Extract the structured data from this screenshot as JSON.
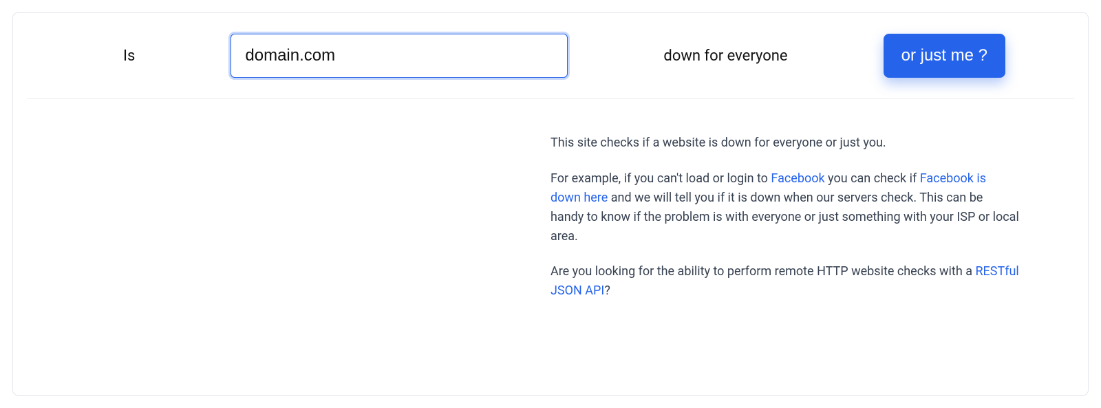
{
  "form": {
    "lead": "Is",
    "domain_value": "domain.com",
    "mid": "down for everyone",
    "button": "or just me ?"
  },
  "content": {
    "p1": "This site checks if a website is down for everyone or just you.",
    "p2": {
      "t1": "For example, if you can't load or login to ",
      "link1": "Facebook",
      "t2": " you can check if ",
      "link2": "Facebook is down here",
      "t3": " and we will tell you if it is down when our servers check. This can be handy to know if the problem is with everyone or just something with your ISP or local area."
    },
    "p3": {
      "t1": "Are you looking for the ability to perform remote HTTP website checks with a ",
      "link1": "RESTful JSON API",
      "t2": "?"
    }
  }
}
